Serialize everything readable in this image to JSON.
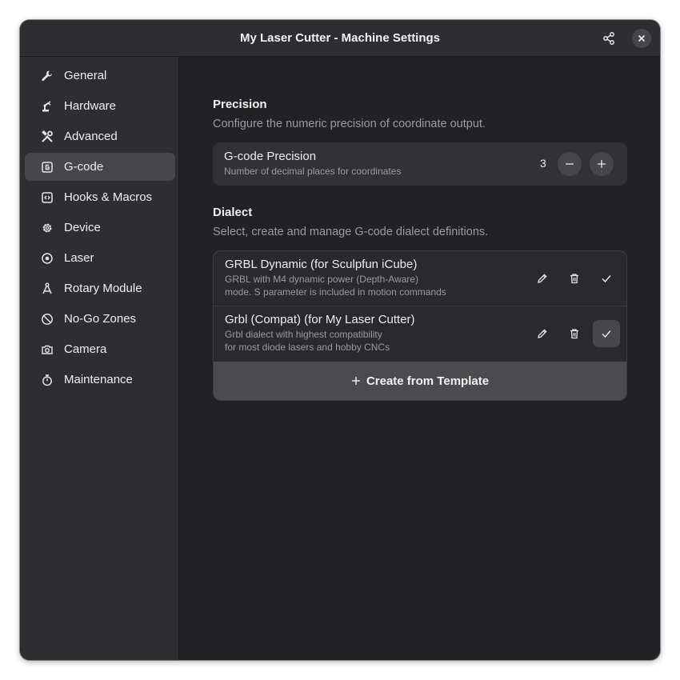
{
  "window": {
    "title": "My Laser Cutter - Machine Settings"
  },
  "sidebar": {
    "items": [
      {
        "label": "General",
        "icon": "wrench-icon"
      },
      {
        "label": "Hardware",
        "icon": "robot-arm-icon"
      },
      {
        "label": "Advanced",
        "icon": "tools-icon"
      },
      {
        "label": "G-code",
        "icon": "g-box-icon",
        "active": true
      },
      {
        "label": "Hooks & Macros",
        "icon": "code-box-icon"
      },
      {
        "label": "Device",
        "icon": "gear-icon"
      },
      {
        "label": "Laser",
        "icon": "target-icon"
      },
      {
        "label": "Rotary Module",
        "icon": "compass-icon"
      },
      {
        "label": "No-Go Zones",
        "icon": "prohibited-icon"
      },
      {
        "label": "Camera",
        "icon": "camera-icon"
      },
      {
        "label": "Maintenance",
        "icon": "stopwatch-icon"
      }
    ]
  },
  "precision": {
    "title": "Precision",
    "description": "Configure the numeric precision of coordinate output.",
    "row_title": "G-code Precision",
    "row_subtitle": "Number of decimal places for coordinates",
    "value": "3"
  },
  "dialect": {
    "title": "Dialect",
    "description": "Select, create and manage G-code dialect definitions.",
    "items": [
      {
        "name": "GRBL Dynamic (for Sculpfun iCube)",
        "desc_line1": "GRBL with M4 dynamic power (Depth-Aware)",
        "desc_line2": "mode. S parameter is included in motion commands",
        "selected": false
      },
      {
        "name": "Grbl (Compat) (for My Laser Cutter)",
        "desc_line1": "Grbl dialect with highest compatibility",
        "desc_line2": "for most diode lasers and hobby CNCs",
        "selected": true
      }
    ],
    "create_label": "Create from Template"
  },
  "colors": {
    "window_bg": "#222226",
    "sidebar_bg": "#2e2e32",
    "active_item": "#46464b",
    "card_bg": "#323236",
    "muted_text": "#9a9a9f"
  }
}
